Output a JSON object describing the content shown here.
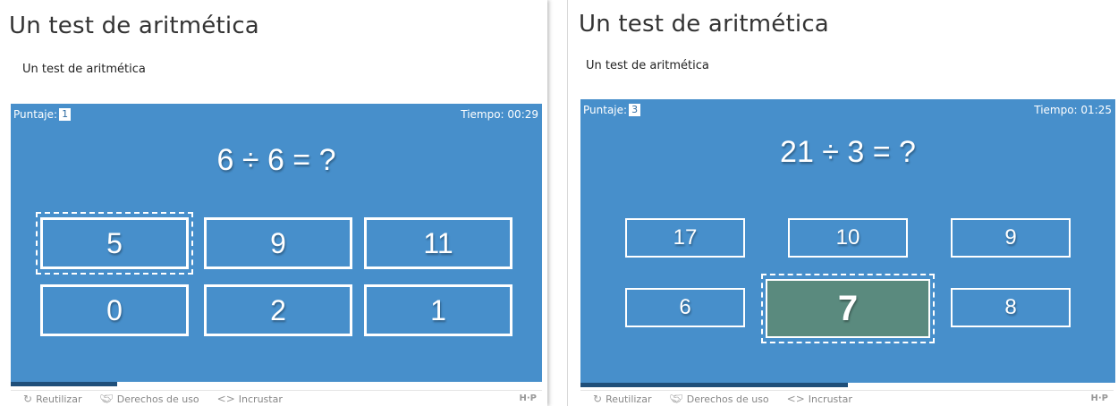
{
  "panels": [
    {
      "title": "Un test de aritmética",
      "subtitle": "Un test de aritmética",
      "score_label": "Puntaje:",
      "score": "1",
      "timer": "Tiempo: 00:29",
      "question": "6 ÷ 6 = ?",
      "answers": [
        "5",
        "9",
        "11",
        "0",
        "2",
        "1"
      ],
      "focused_answer": "5",
      "progress": 0.2,
      "footer": {
        "reuse": "Reutilizar",
        "rights": "Derechos de uso",
        "embed": "Incrustar",
        "logo": "H·P"
      }
    },
    {
      "title": "Un test de aritmética",
      "subtitle": "Un test de aritmética",
      "score_label": "Puntaje:",
      "score": "3",
      "timer": "Tiempo: 01:25",
      "question": "21 ÷ 3 = ?",
      "answers": [
        "17",
        "10",
        "9",
        "6",
        "7",
        "8"
      ],
      "selected_answer": "7",
      "progress": 0.5,
      "footer": {
        "reuse": "Reutilizar",
        "rights": "Derechos de uso",
        "embed": "Incrustar",
        "logo": "H·P"
      }
    }
  ],
  "colors": {
    "game_bg": "#478fcb",
    "selected_bg": "#5a8a7e",
    "progress": "#1f4f7a"
  },
  "icons": {
    "reuse": "refresh-icon",
    "rights": "handshake-icon",
    "embed": "code-icon"
  }
}
